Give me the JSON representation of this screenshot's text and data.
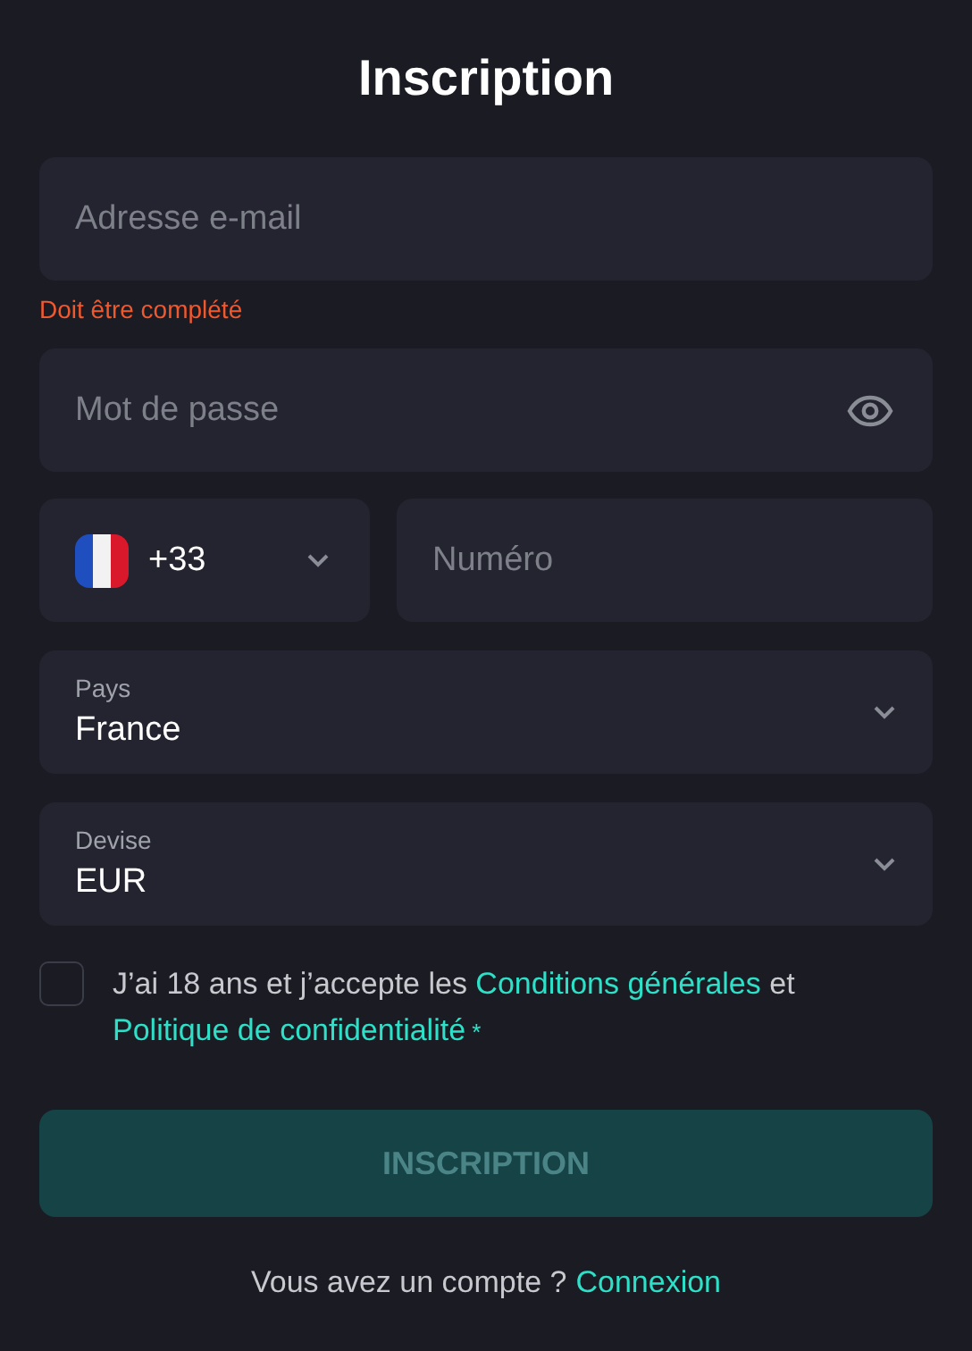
{
  "title": "Inscription",
  "email": {
    "placeholder": "Adresse e-mail",
    "error": "Doit être complété"
  },
  "password": {
    "placeholder": "Mot de passe"
  },
  "phone": {
    "code": "+33",
    "placeholder": "Numéro"
  },
  "selects": [
    {
      "label": "Pays",
      "value": "France"
    },
    {
      "label": "Devise",
      "value": "EUR"
    }
  ],
  "terms": {
    "checked": false,
    "parts": [
      {
        "kind": "text",
        "text": "J’ai 18 ans et j’accepte les "
      },
      {
        "kind": "link",
        "text": "Conditions générales"
      },
      {
        "kind": "text",
        "text": " et "
      },
      {
        "kind": "link",
        "text": "Politique de confidentialité"
      },
      {
        "kind": "required",
        "text": "*"
      }
    ]
  },
  "submit": {
    "label": "INSCRIPTION",
    "disabled": true
  },
  "footer": {
    "text": "Vous avez un compte ?",
    "link": "Connexion"
  }
}
